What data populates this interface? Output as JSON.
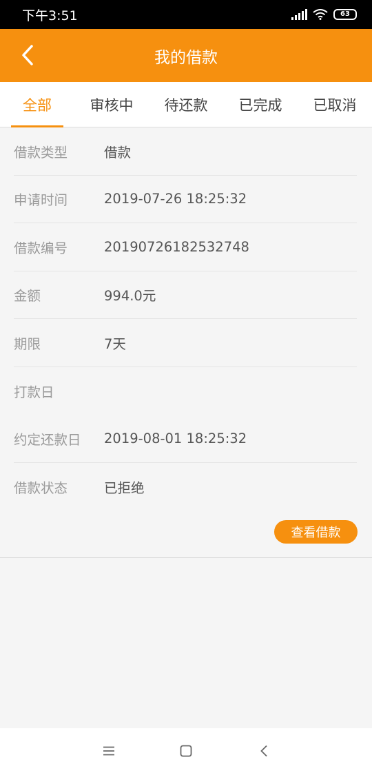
{
  "status_bar": {
    "time": "下午3:51",
    "battery": "63",
    "icons": [
      "signal-icon",
      "wifi-icon",
      "battery-icon"
    ]
  },
  "header": {
    "title": "我的借款",
    "back_icon": "chevron-left-icon"
  },
  "tabs": [
    {
      "label": "全部",
      "active": true
    },
    {
      "label": "审核中",
      "active": false
    },
    {
      "label": "待还款",
      "active": false
    },
    {
      "label": "已完成",
      "active": false
    },
    {
      "label": "已取消",
      "active": false
    }
  ],
  "loan": {
    "rows": [
      {
        "label": "借款类型",
        "value": "借款"
      },
      {
        "label": "申请时间",
        "value": "2019-07-26 18:25:32"
      },
      {
        "label": "借款编号",
        "value": "20190726182532748"
      },
      {
        "label": "金额",
        "value": "994.0元"
      },
      {
        "label": "期限",
        "value": "7天"
      },
      {
        "label": "打款日",
        "value": ""
      },
      {
        "label": "约定还款日",
        "value": "2019-08-01 18:25:32"
      },
      {
        "label": "借款状态",
        "value": "已拒绝"
      }
    ],
    "view_button": "查看借款"
  },
  "system_nav": {
    "icons": [
      "menu-icon",
      "home-icon",
      "back-icon"
    ]
  },
  "colors": {
    "accent": "#f6900f",
    "background": "#f5f5f5",
    "label_text": "#9a9a9a",
    "value_text": "#555555"
  }
}
